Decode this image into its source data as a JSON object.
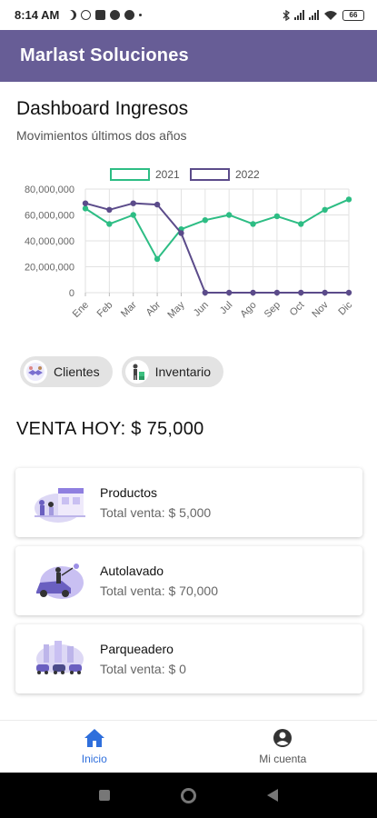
{
  "status_bar": {
    "time": "8:14 AM",
    "battery": "66"
  },
  "app_bar": {
    "title": "Marlast Soluciones"
  },
  "dashboard": {
    "title": "Dashboard Ingresos",
    "subtitle": "Movimientos últimos dos años"
  },
  "chart_data": {
    "type": "line",
    "categories": [
      "Ene",
      "Feb",
      "Mar",
      "Abr",
      "May",
      "Jun",
      "Jul",
      "Ago",
      "Sep",
      "Oct",
      "Nov",
      "Dic"
    ],
    "series": [
      {
        "name": "2021",
        "color": "#2dbd84",
        "values": [
          65000000,
          53000000,
          60000000,
          26000000,
          49000000,
          56000000,
          60000000,
          53000000,
          59000000,
          53000000,
          64000000,
          72000000
        ]
      },
      {
        "name": "2022",
        "color": "#5b4b8a",
        "values": [
          69000000,
          64000000,
          69000000,
          68000000,
          46000000,
          0,
          0,
          0,
          0,
          0,
          0,
          0
        ]
      }
    ],
    "y_ticks": [
      "0",
      "20,000,000",
      "40,000,000",
      "60,000,000",
      "80,000,000"
    ],
    "ylim": [
      0,
      80000000
    ],
    "legend_position": "top-center",
    "grid": true
  },
  "chips": [
    {
      "label": "Clientes",
      "icon": "handshake-icon"
    },
    {
      "label": "Inventario",
      "icon": "worker-icon"
    }
  ],
  "venta_hoy": "VENTA HOY: $ 75,000",
  "cards": [
    {
      "title": "Productos",
      "subtitle": "Total venta: $ 5,000",
      "icon": "store-illustration"
    },
    {
      "title": "Autolavado",
      "subtitle": "Total venta: $ 70,000",
      "icon": "car-wash-illustration"
    },
    {
      "title": "Parqueadero",
      "subtitle": "Total venta: $ 0",
      "icon": "parking-illustration"
    }
  ],
  "bottom_nav": [
    {
      "label": "Inicio",
      "icon": "home-icon",
      "active": true
    },
    {
      "label": "Mi cuenta",
      "icon": "account-icon",
      "active": false
    }
  ],
  "colors": {
    "app_bar": "#675d96",
    "accent": "#2f6fdc",
    "series_2021": "#2dbd84",
    "series_2022": "#5b4b8a"
  }
}
